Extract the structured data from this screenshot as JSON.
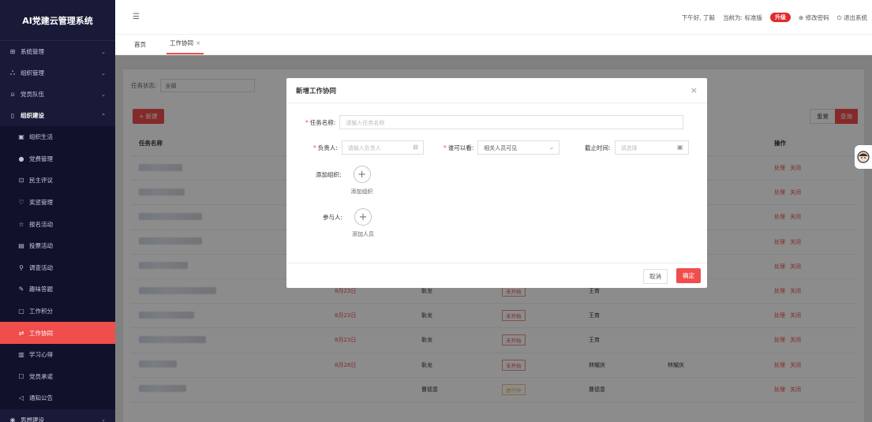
{
  "app": {
    "title": "AI党建云管理系统"
  },
  "sidebar": {
    "items": [
      {
        "label": "系统管理",
        "icon": "grid-icon"
      },
      {
        "label": "组织管理",
        "icon": "org-icon"
      },
      {
        "label": "党员队伍",
        "icon": "user-icon"
      },
      {
        "label": "组织建设",
        "icon": "doc-icon"
      }
    ],
    "sub": [
      {
        "label": "组织生活",
        "icon": "calendar-icon"
      },
      {
        "label": "党费管理",
        "icon": "coin-icon"
      },
      {
        "label": "民主评议",
        "icon": "vote-icon"
      },
      {
        "label": "奖惩管理",
        "icon": "trophy-icon"
      },
      {
        "label": "报名活动",
        "icon": "star-icon"
      },
      {
        "label": "投票活动",
        "icon": "ballot-icon"
      },
      {
        "label": "调查活动",
        "icon": "search-icon"
      },
      {
        "label": "趣味答题",
        "icon": "quiz-icon"
      },
      {
        "label": "工作积分",
        "icon": "score-icon"
      },
      {
        "label": "工作协同",
        "icon": "collab-icon"
      },
      {
        "label": "学习心得",
        "icon": "book-icon"
      },
      {
        "label": "党员承诺",
        "icon": "promise-icon"
      },
      {
        "label": "通知公告",
        "icon": "notice-icon"
      }
    ],
    "last": {
      "label": "思想建设",
      "icon": "globe-icon"
    }
  },
  "topbar": {
    "greeting": "下午好, 丁毅",
    "edition": "当前为: 标准版",
    "upgrade": "升级",
    "change_password": "修改密码",
    "logout": "退出系统"
  },
  "tabs": [
    {
      "label": "首页"
    },
    {
      "label": "工作协同"
    }
  ],
  "filter": {
    "label": "任务状态:",
    "value": "全部"
  },
  "buttons": {
    "new": "+ 新建",
    "reset": "重置",
    "query": "查询"
  },
  "table": {
    "headers": {
      "name": "任务名称",
      "op": "操作"
    },
    "rows": [
      {
        "date": "",
        "creator": "",
        "status": "",
        "owner": "",
        "viewer": ""
      },
      {
        "date": "",
        "creator": "",
        "status": "",
        "owner": "",
        "viewer": ""
      },
      {
        "date": "",
        "creator": "",
        "status": "",
        "owner": "",
        "viewer": ""
      },
      {
        "date": "",
        "creator": "",
        "status": "",
        "owner": "",
        "viewer": ""
      },
      {
        "date": "",
        "creator": "",
        "status": "",
        "owner": "",
        "viewer": ""
      },
      {
        "date": "8月23日",
        "creator": "耿龙",
        "status": "未开始",
        "owner": "王育",
        "viewer": ""
      },
      {
        "date": "8月23日",
        "creator": "耿龙",
        "status": "未开始",
        "owner": "王育",
        "viewer": ""
      },
      {
        "date": "8月23日",
        "creator": "耿龙",
        "status": "未开始",
        "owner": "王育",
        "viewer": ""
      },
      {
        "date": "8月28日",
        "creator": "耿龙",
        "status": "未开始",
        "owner": "林耀庆",
        "viewer": "林耀庆"
      },
      {
        "date": "",
        "creator": "曹德意",
        "status": "进行中",
        "owner": "曹德意",
        "viewer": ""
      }
    ],
    "op_handle": "处理",
    "op_close": "关闭"
  },
  "dialog": {
    "title": "新增工作协同",
    "name_label": "任务名称:",
    "name_placeholder": "请输入任务名称",
    "owner_label": "负责人:",
    "owner_placeholder": "请输入负责人",
    "visible_label": "谁可以看:",
    "visible_value": "相关人员可见",
    "deadline_label": "截止时间:",
    "deadline_placeholder": "请选择",
    "org_label": "添加组织:",
    "org_add": "添加组织",
    "member_label": "参与人:",
    "member_add": "添加人员",
    "cancel": "取消",
    "ok": "确定"
  },
  "colors": {
    "accent": "#f04d4d",
    "sidebar": "#191a37"
  }
}
